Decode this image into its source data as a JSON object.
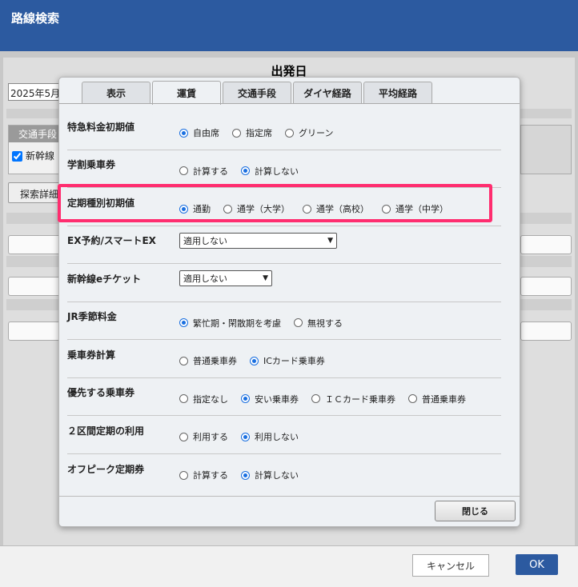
{
  "window": {
    "title": "路線検索"
  },
  "background": {
    "section_title": "出発日",
    "date_value": "2025年5月",
    "transport_header": "交通手段",
    "transport_item": "新幹線",
    "detail_button": "探索詳細"
  },
  "modal": {
    "tabs": [
      {
        "label": "表示",
        "active": false
      },
      {
        "label": "運賃",
        "active": true
      },
      {
        "label": "交通手段",
        "active": false
      },
      {
        "label": "ダイヤ経路",
        "active": false
      },
      {
        "label": "平均経路",
        "active": false
      }
    ],
    "rows": [
      {
        "label": "特急料金初期値",
        "options": [
          {
            "label": "自由席",
            "selected": true
          },
          {
            "label": "指定席",
            "selected": false
          },
          {
            "label": "グリーン",
            "selected": false
          }
        ]
      },
      {
        "label": "学割乗車券",
        "options": [
          {
            "label": "計算する",
            "selected": false
          },
          {
            "label": "計算しない",
            "selected": true
          }
        ]
      },
      {
        "label": "定期種別初期値",
        "options": [
          {
            "label": "通勤",
            "selected": true
          },
          {
            "label": "通学（大学）",
            "selected": false
          },
          {
            "label": "通学（高校）",
            "selected": false
          },
          {
            "label": "通学（中学）",
            "selected": false
          }
        ]
      },
      {
        "label": "EX予約/スマートEX",
        "select_value": "適用しない"
      },
      {
        "label": "新幹線eチケット",
        "select_value": "適用しない"
      },
      {
        "label": "JR季節料金",
        "options": [
          {
            "label": "繁忙期・閑散期を考慮",
            "selected": true
          },
          {
            "label": "無視する",
            "selected": false
          }
        ]
      },
      {
        "label": "乗車券計算",
        "options": [
          {
            "label": "普通乗車券",
            "selected": false
          },
          {
            "label": "ICカード乗車券",
            "selected": true
          }
        ]
      },
      {
        "label": "優先する乗車券",
        "options": [
          {
            "label": "指定なし",
            "selected": false
          },
          {
            "label": "安い乗車券",
            "selected": true
          },
          {
            "label": "ＩＣカード乗車券",
            "selected": false
          },
          {
            "label": "普通乗車券",
            "selected": false
          }
        ]
      },
      {
        "label": "２区間定期の利用",
        "options": [
          {
            "label": "利用する",
            "selected": false
          },
          {
            "label": "利用しない",
            "selected": true
          }
        ]
      },
      {
        "label": "オフピーク定期券",
        "options": [
          {
            "label": "計算する",
            "selected": false
          },
          {
            "label": "計算しない",
            "selected": true
          }
        ]
      }
    ],
    "close_button": "閉じる"
  },
  "footer": {
    "cancel_button": "キャンセル",
    "ok_button": "OK"
  },
  "colors": {
    "header": "#2c5aa0",
    "highlight": "#ff2d6f",
    "radio_selected": "#1a6fe0"
  }
}
